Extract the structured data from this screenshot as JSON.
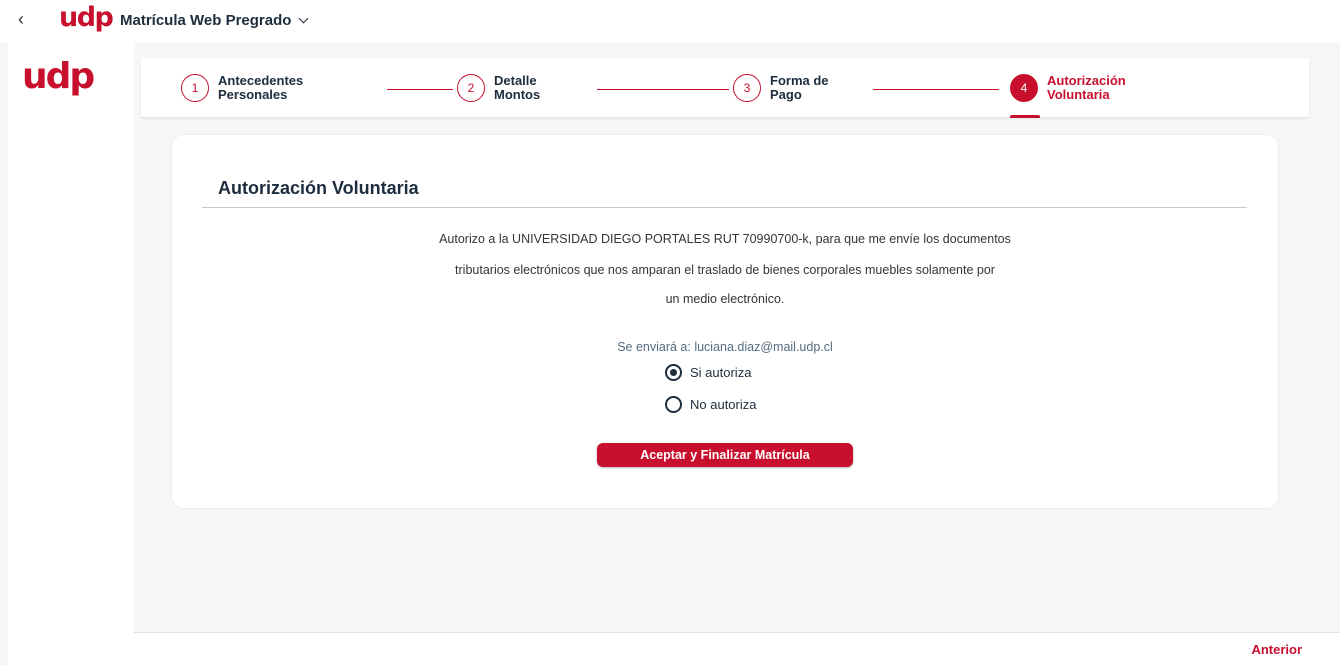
{
  "shellbar": {
    "back_symbol": "‹",
    "logo": "udp",
    "app_title": "Matrícula Web Pregrado"
  },
  "sidepane": {
    "logo": "udp"
  },
  "wizard": {
    "steps": [
      {
        "number": "1",
        "line1": "Antecedentes",
        "line2": "Personales"
      },
      {
        "number": "2",
        "line1": "Detalle",
        "line2": "Montos"
      },
      {
        "number": "3",
        "line1": "Forma de",
        "line2": "Pago"
      },
      {
        "number": "4",
        "line1": "Autorización",
        "line2": "Voluntaria"
      }
    ],
    "active_step": 4
  },
  "card": {
    "title": "Autorización Voluntaria",
    "paragraph_lines": [
      "Autorizo a la UNIVERSIDAD DIEGO PORTALES RUT 70990700-k, para que me envíe los documentos",
      "tributarios electrónicos que nos amparan el traslado de bienes corporales muebles solamente por",
      "un medio electrónico."
    ],
    "email_line": "Se enviará a: luciana.diaz@mail.udp.cl",
    "options": [
      {
        "label": "Si autoriza",
        "selected": true
      },
      {
        "label": "No autoriza",
        "selected": false
      }
    ],
    "submit_label": "Aceptar y Finalizar Matrícula"
  },
  "footer": {
    "previous_label": "Anterior"
  },
  "colors": {
    "brand": "#c8102e",
    "text": "#1d2d3e",
    "background": "#f5f6f7"
  }
}
